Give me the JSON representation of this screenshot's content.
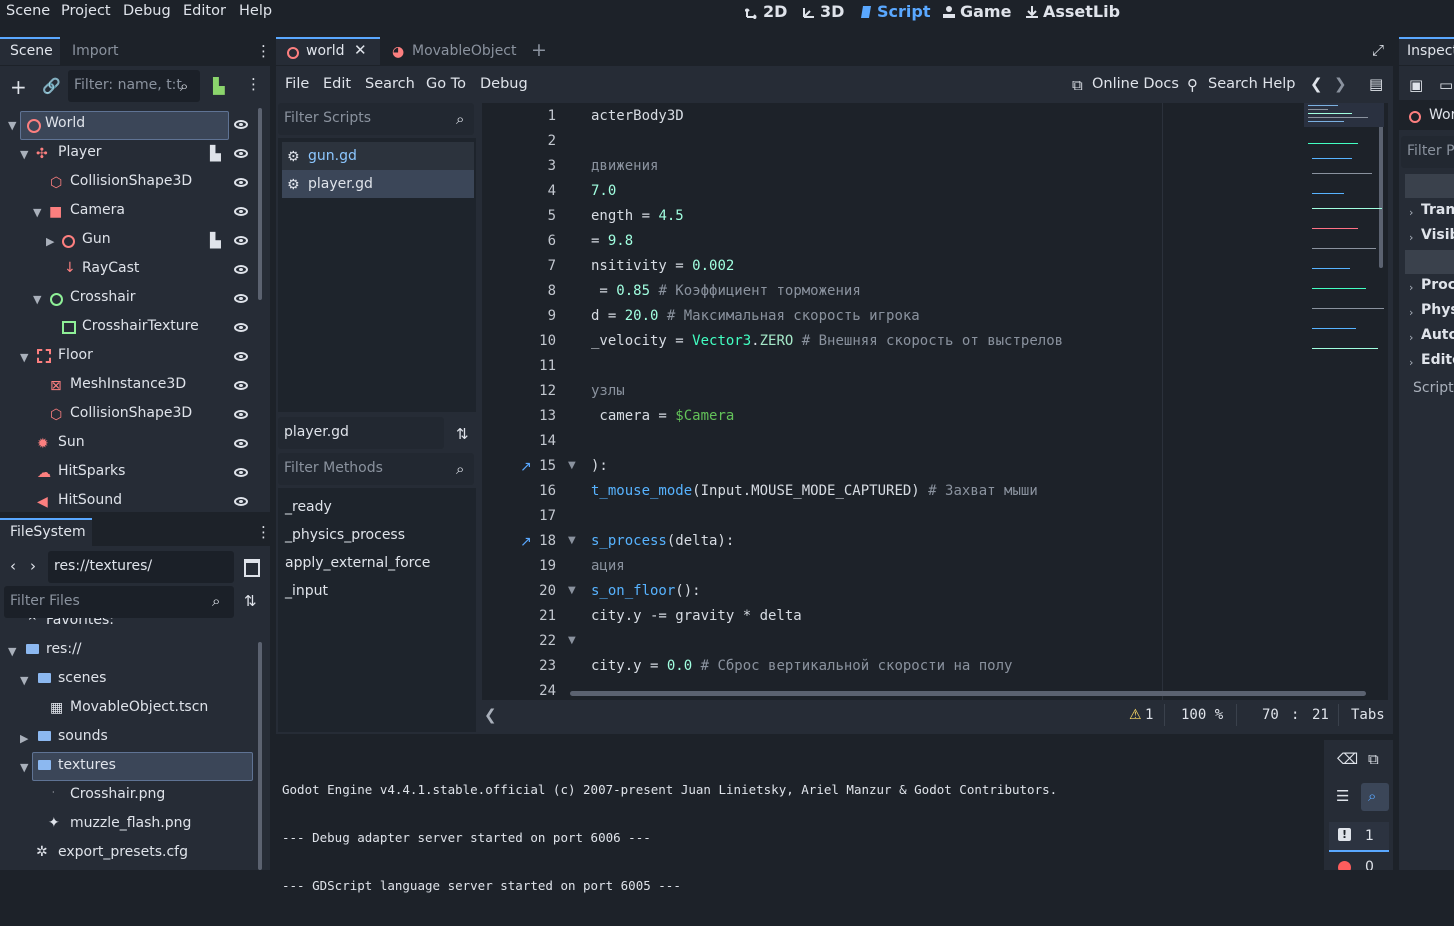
{
  "menu": [
    "Scene",
    "Project",
    "Debug",
    "Editor",
    "Help"
  ],
  "workspaces": [
    "2D",
    "3D",
    "Script",
    "Game",
    "AssetLib"
  ],
  "scene_dock": {
    "tabs": [
      "Scene",
      "Import"
    ],
    "filter_placeholder": "Filter: name, t:t",
    "nodes": [
      "World",
      "Player",
      "CollisionShape3D",
      "Camera",
      "Gun",
      "RayCast",
      "Crosshair",
      "CrosshairTexture",
      "Floor",
      "MeshInstance3D",
      "CollisionShape3D",
      "Sun",
      "HitSparks",
      "HitSound"
    ]
  },
  "filesystem": {
    "tab": "FileSystem",
    "path": "res://textures/",
    "filter_placeholder": "Filter Files",
    "items": [
      "Favorites:",
      "res://",
      "scenes",
      "MovableObject.tscn",
      "sounds",
      "textures",
      "Crosshair.png",
      "muzzle_flash.png",
      "export_presets.cfg"
    ]
  },
  "script_tabs": [
    "world",
    "MovableObject"
  ],
  "script_menu": [
    "File",
    "Edit",
    "Search",
    "Go To",
    "Debug"
  ],
  "help_links": [
    "Online Docs",
    "Search Help"
  ],
  "script_list": {
    "filter_placeholder": "Filter Scripts",
    "scripts": [
      "gun.gd",
      "player.gd"
    ],
    "current": "player.gd",
    "methods_placeholder": "Filter Methods",
    "methods": [
      "_ready",
      "_physics_process",
      "apply_external_force",
      "_input"
    ]
  },
  "code_lines": [
    {
      "n": "1",
      "t": "acterBody3D"
    },
    {
      "n": "2",
      "t": ""
    },
    {
      "n": "3",
      "t": "движения"
    },
    {
      "n": "4",
      "t": "7.0"
    },
    {
      "n": "5",
      "t": "ength = 4.5"
    },
    {
      "n": "6",
      "t": "= 9.8"
    },
    {
      "n": "7",
      "t": "nsitivity = 0.002"
    },
    {
      "n": "8",
      "t": " = 0.85 # Коэффициент торможения"
    },
    {
      "n": "9",
      "t": "d = 20.0 # Максимальная скорость игрока"
    },
    {
      "n": "10",
      "t": "_velocity = Vector3.ZERO # Внешняя скорость от выстрелов"
    },
    {
      "n": "11",
      "t": ""
    },
    {
      "n": "12",
      "t": "узлы"
    },
    {
      "n": "13",
      "t": " camera = $Camera"
    },
    {
      "n": "14",
      "t": ""
    },
    {
      "n": "15",
      "t": "):"
    },
    {
      "n": "16",
      "t": "t_mouse_mode(Input.MOUSE_MODE_CAPTURED) # Захват мыши"
    },
    {
      "n": "17",
      "t": ""
    },
    {
      "n": "18",
      "t": "s_process(delta):"
    },
    {
      "n": "19",
      "t": "ация"
    },
    {
      "n": "20",
      "t": "s_on_floor():"
    },
    {
      "n": "21",
      "t": "city.y -= gravity * delta"
    },
    {
      "n": "22",
      "t": ""
    },
    {
      "n": "23",
      "t": "city.y = 0.0 # Сброс вертикальной скорости на полу"
    },
    {
      "n": "24",
      "t": ""
    }
  ],
  "status": {
    "warnings": "1",
    "zoom": "100 %",
    "line": "70",
    "col": "21",
    "indent": "Tabs"
  },
  "output_lines": [
    "Godot Engine v4.4.1.stable.official (c) 2007-present Juan Linietsky, Ariel Manzur & Godot Contributors.",
    "--- Debug adapter server started on port 6006 ---",
    "--- GDScript language server started on port 6005 ---"
  ],
  "output_badges": {
    "warnings": "1",
    "errors": "0"
  },
  "inspector": {
    "tab": "Inspect",
    "node": "Wor",
    "filter_placeholder": "Filter P",
    "sections": [
      "Trans",
      "Visib",
      "Proce",
      "Phys",
      "Auto",
      "Edito"
    ],
    "script_label": "Script"
  }
}
